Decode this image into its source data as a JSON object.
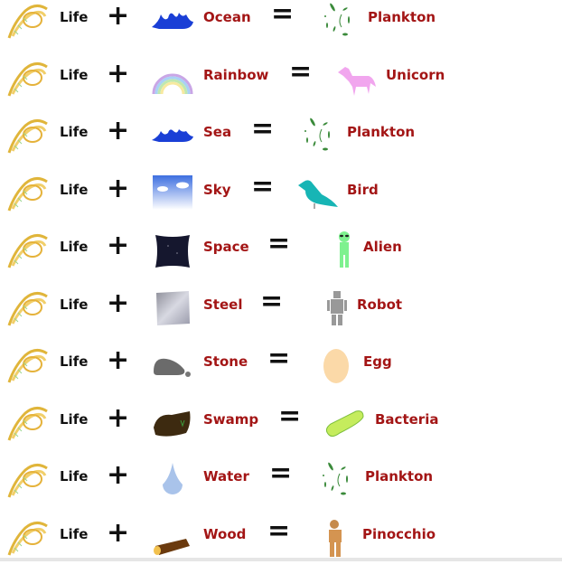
{
  "rows": [
    {
      "base": "Life",
      "op": "+",
      "ingredient": "Ocean",
      "eq": "=",
      "result": "Plankton"
    },
    {
      "base": "Life",
      "op": "+",
      "ingredient": "Rainbow",
      "eq": "=",
      "result": "Unicorn"
    },
    {
      "base": "Life",
      "op": "+",
      "ingredient": "Sea",
      "eq": "=",
      "result": "Plankton"
    },
    {
      "base": "Life",
      "op": "+",
      "ingredient": "Sky",
      "eq": "=",
      "result": "Bird"
    },
    {
      "base": "Life",
      "op": "+",
      "ingredient": "Space",
      "eq": "=",
      "result": "Alien"
    },
    {
      "base": "Life",
      "op": "+",
      "ingredient": "Steel",
      "eq": "=",
      "result": "Robot"
    },
    {
      "base": "Life",
      "op": "+",
      "ingredient": "Stone",
      "eq": "=",
      "result": "Egg"
    },
    {
      "base": "Life",
      "op": "+",
      "ingredient": "Swamp",
      "eq": "=",
      "result": "Bacteria"
    },
    {
      "base": "Life",
      "op": "+",
      "ingredient": "Water",
      "eq": "=",
      "result": "Plankton"
    },
    {
      "base": "Life",
      "op": "+",
      "ingredient": "Wood",
      "eq": "=",
      "result": "Pinocchio"
    }
  ],
  "icons": {
    "base": "dna-icon",
    "ingredients": [
      "ocean-wave-icon",
      "rainbow-icon",
      "sea-wave-icon",
      "sky-icon",
      "space-icon",
      "steel-icon",
      "stone-icon",
      "swamp-icon",
      "water-drop-icon",
      "wood-log-icon"
    ],
    "results": [
      "plankton-icon",
      "unicorn-icon",
      "plankton-icon",
      "bird-icon",
      "alien-icon",
      "robot-icon",
      "egg-icon",
      "bacteria-icon",
      "plankton-icon",
      "pinocchio-icon"
    ]
  },
  "colors": {
    "label": "#a31515",
    "text": "#111111"
  }
}
